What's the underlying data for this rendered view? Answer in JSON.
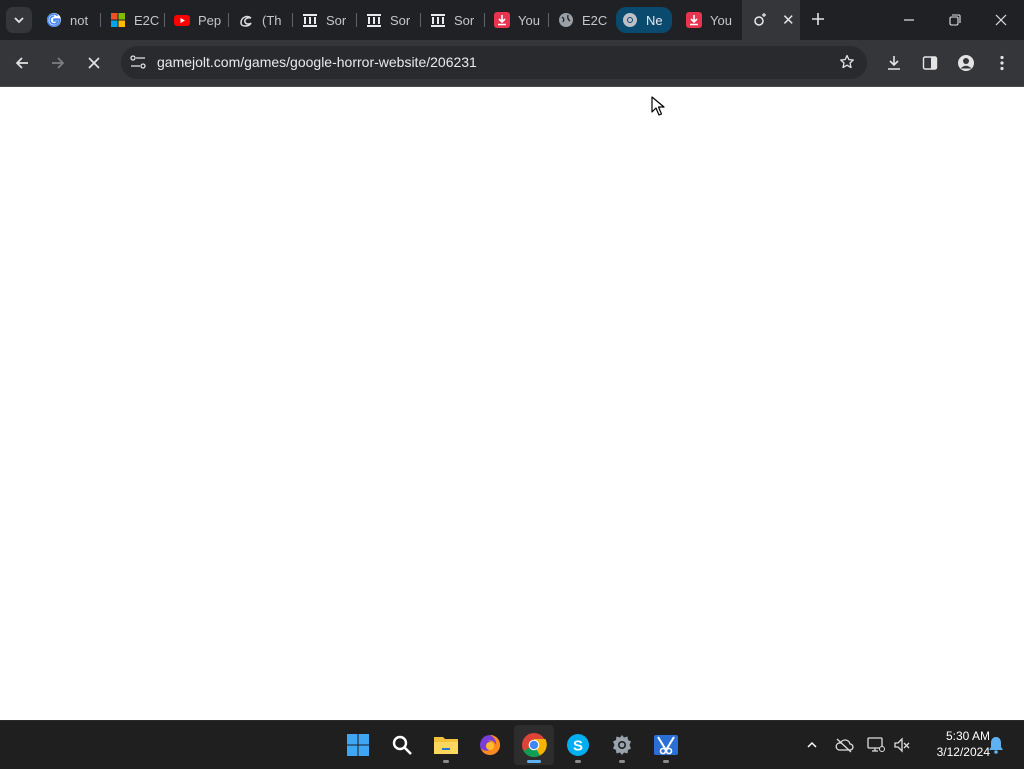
{
  "browser": {
    "tabs": [
      {
        "title": "not",
        "icon": "google-icon"
      },
      {
        "title": "E2C",
        "icon": "microsoft-icon"
      },
      {
        "title": "Pep",
        "icon": "youtube-icon"
      },
      {
        "title": "(Th",
        "icon": "edge-like-icon"
      },
      {
        "title": "Sor",
        "icon": "bank-icon"
      },
      {
        "title": "Sor",
        "icon": "bank-icon"
      },
      {
        "title": "Sor",
        "icon": "bank-icon"
      },
      {
        "title": "You",
        "icon": "download-red-icon"
      },
      {
        "title": "E2C",
        "icon": "globe-icon"
      },
      {
        "title": "Ne",
        "icon": "chrome-icon"
      },
      {
        "title": "You",
        "icon": "download-red-icon"
      },
      {
        "title": "",
        "icon": "loading-icon"
      }
    ],
    "address": {
      "url": "gamejolt.com/games/google-horror-website/206231"
    }
  },
  "taskbar": {
    "apps": [
      "windows-start",
      "search",
      "file-explorer",
      "firefox",
      "chrome",
      "skype",
      "settings",
      "snipping-tool"
    ],
    "clock": {
      "time": "5:30 AM",
      "date": "3/12/2024"
    }
  },
  "colors": {
    "tabstrip": "#202124",
    "toolbar": "#35363a",
    "omnibox": "#282a2d",
    "taskbar": "#1f1f1f",
    "accent": "#5fb2f2"
  }
}
